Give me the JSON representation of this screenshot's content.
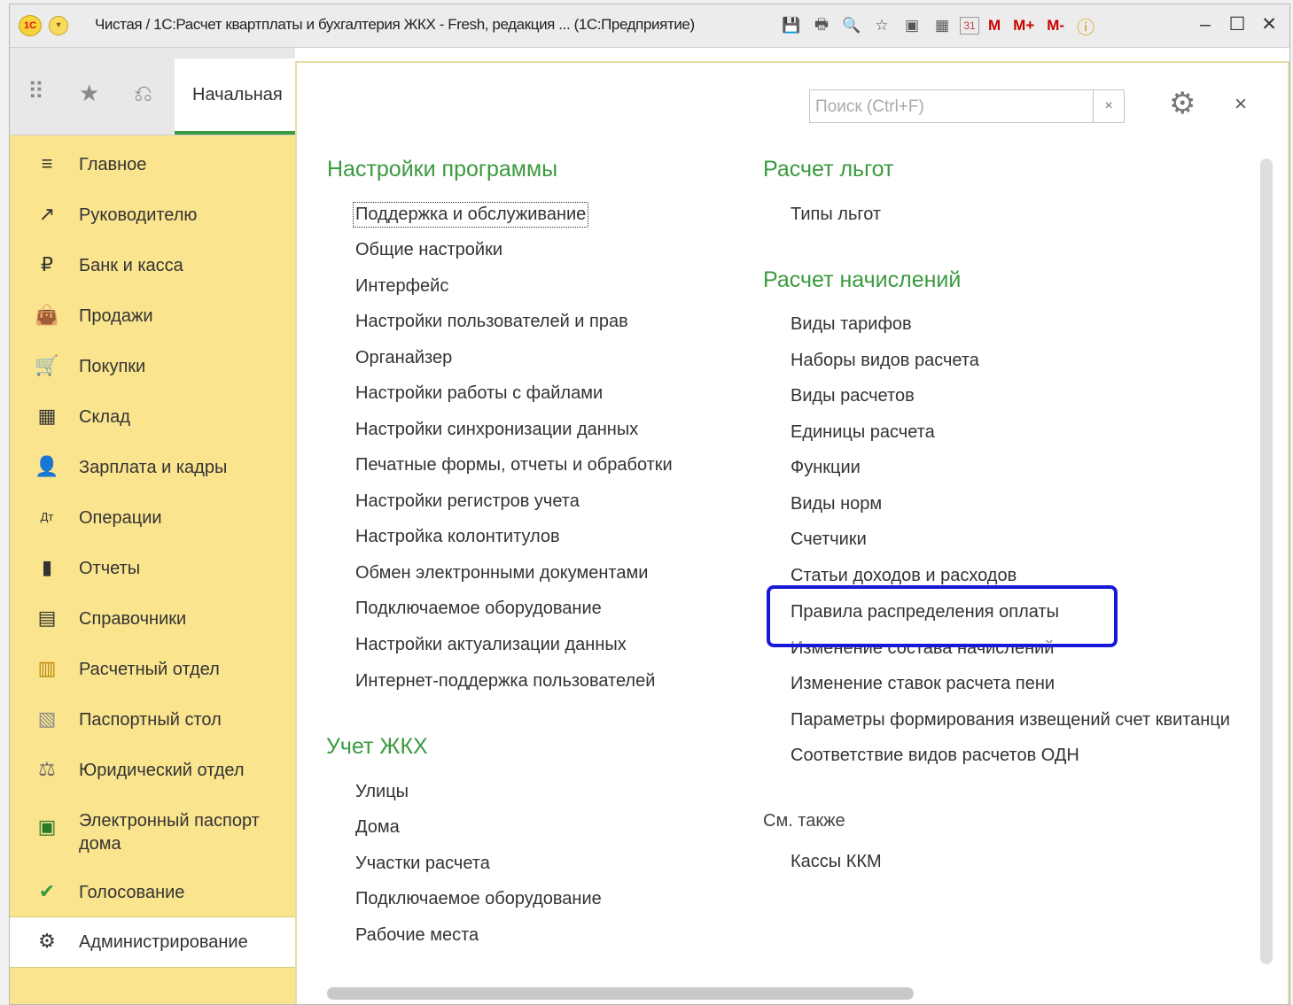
{
  "window": {
    "title": "Чистая / 1С:Расчет квартплаты и бухгалтерия ЖКХ - Fresh, редакция ...  (1С:Предприятие)",
    "minimize": "–",
    "maximize": "☐",
    "close": "✕"
  },
  "toolbar": {
    "save_icon": "💾",
    "print_icon": "🖶",
    "preview_icon": "🔍",
    "favorites_icon": "☆",
    "bookmark_icon": "▣",
    "calculator_icon": "▦",
    "calendar_icon": "31",
    "memory_m": "M",
    "memory_plus": "M+",
    "memory_minus": "M-",
    "info_icon": "ⓘ"
  },
  "topbar": {
    "apps_icon": "⠿",
    "favorites_icon": "★",
    "history_icon": "⎌",
    "home_tab": "Начальная"
  },
  "sidebar": {
    "items": [
      {
        "label": "Главное",
        "icon": "≡"
      },
      {
        "label": "Руководителю",
        "icon": "↗"
      },
      {
        "label": "Банк и касса",
        "icon": "₽"
      },
      {
        "label": "Продажи",
        "icon": "👜"
      },
      {
        "label": "Покупки",
        "icon": "🛒"
      },
      {
        "label": "Склад",
        "icon": "▦"
      },
      {
        "label": "Зарплата и кадры",
        "icon": "👤"
      },
      {
        "label": "Операции",
        "icon": "Дт"
      },
      {
        "label": "Отчеты",
        "icon": "▮"
      },
      {
        "label": "Справочники",
        "icon": "▤"
      },
      {
        "label": "Расчетный отдел",
        "icon": "▥"
      },
      {
        "label": "Паспортный стол",
        "icon": "▧"
      },
      {
        "label": "Юридический отдел",
        "icon": "⚖"
      },
      {
        "label": "Электронный паспорт",
        "label2": "дома",
        "icon": "▣"
      },
      {
        "label": "Голосование",
        "icon": "✔"
      },
      {
        "label": "Администрирование",
        "icon": "⚙"
      }
    ]
  },
  "search": {
    "placeholder": "Поиск (Ctrl+F)",
    "clear": "×"
  },
  "panel": {
    "gear_icon": "⚙",
    "close": "×"
  },
  "sections": {
    "settings": {
      "title": "Настройки программы",
      "links": [
        "Поддержка и обслуживание",
        "Общие настройки",
        "Интерфейс",
        "Настройки пользователей и прав",
        "Органайзер",
        "Настройки работы с файлами",
        "Настройки синхронизации данных",
        "Печатные формы, отчеты и обработки",
        "Настройки регистров учета",
        "Настройка колонтитулов",
        "Обмен электронными документами",
        "Подключаемое оборудование",
        "Настройки актуализации данных",
        "Интернет-поддержка пользователей"
      ]
    },
    "housing": {
      "title": "Учет ЖКХ",
      "links": [
        "Улицы",
        "Дома",
        "Участки расчета",
        "Подключаемое оборудование",
        "Рабочие места"
      ]
    },
    "benefits": {
      "title": "Расчет льгот",
      "links": [
        "Типы льгот"
      ]
    },
    "charges": {
      "title": "Расчет начислений",
      "links": [
        "Виды тарифов",
        "Наборы видов расчета",
        "Виды расчетов",
        "Единицы расчета",
        "Функции",
        "Виды норм",
        "Счетчики",
        "Статьи доходов и расходов",
        "Правила распределения оплаты",
        "Изменение состава начислений",
        "Изменение ставок расчета пени",
        "Параметры формирования извещений счет квитанци",
        "Соответствие видов расчетов ОДН"
      ]
    },
    "see_also": {
      "title": "См. также",
      "links": [
        "Кассы ККМ"
      ]
    }
  }
}
